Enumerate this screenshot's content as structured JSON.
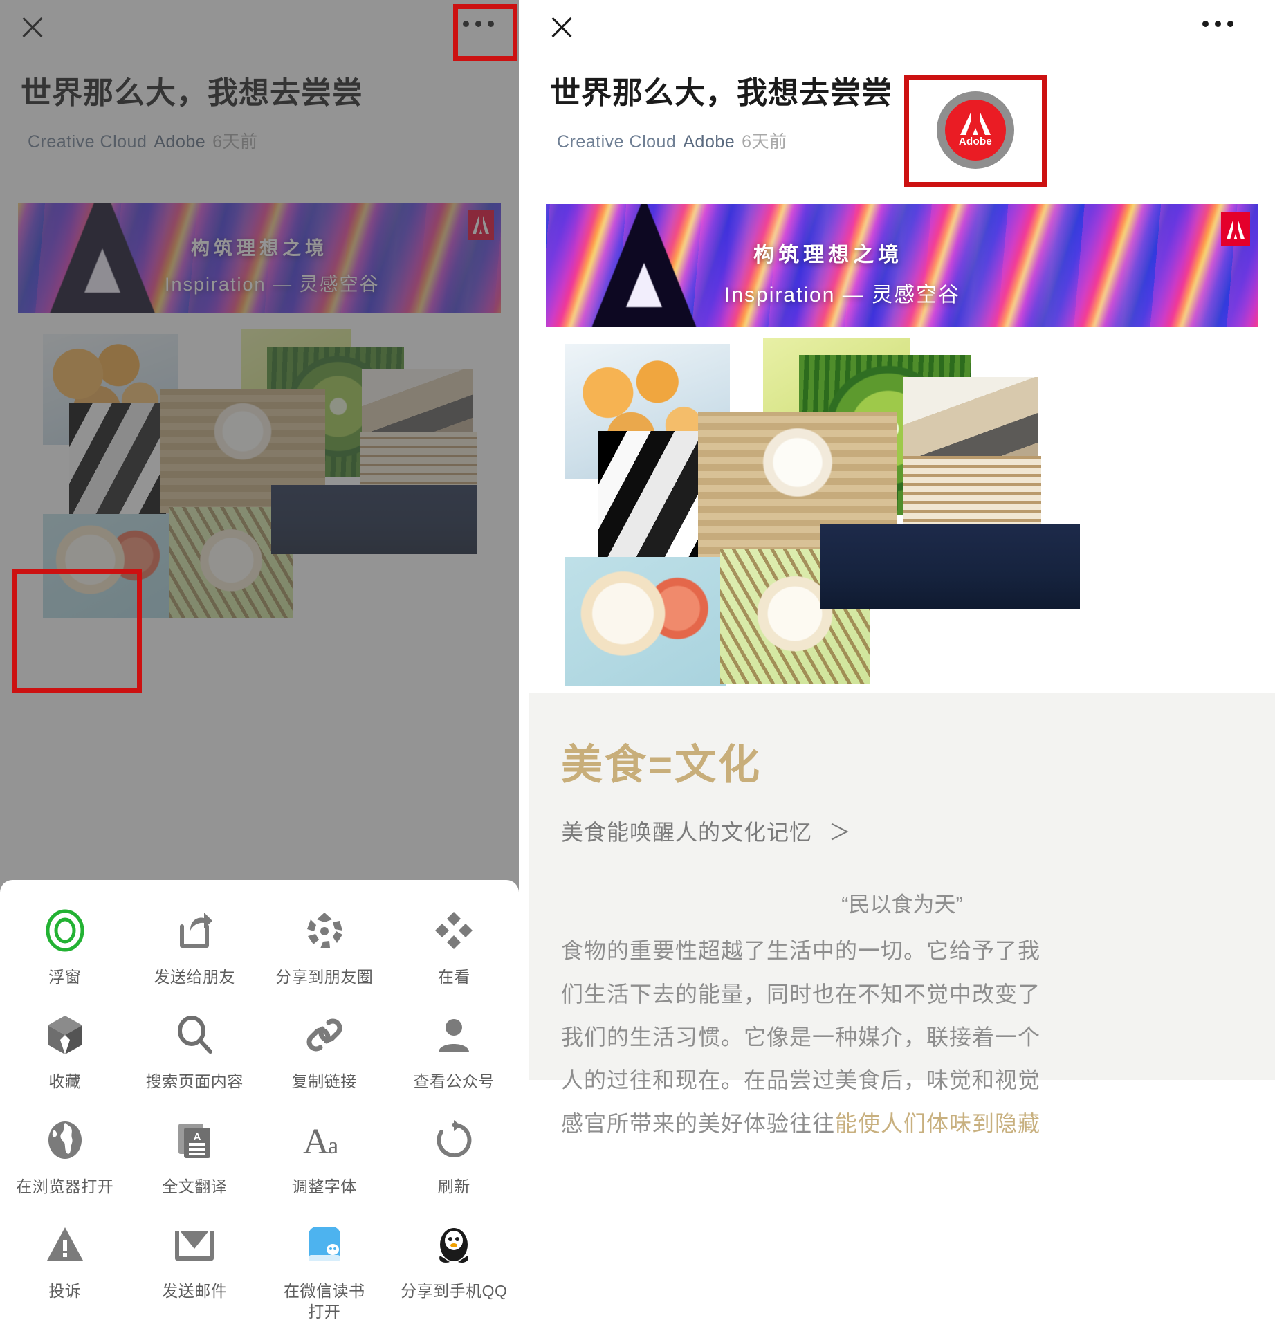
{
  "meta": {
    "app": "WeChat Official Account Article",
    "screen_description": "Two side-by-side mobile screenshots of a WeChat article; left shows the more-options action sheet, right shows the article page"
  },
  "article": {
    "title": "世界那么大，我想去尝尝",
    "account": "Creative Cloud",
    "brand": "Adobe",
    "time": "6天前",
    "close_icon": "close-icon",
    "more_icon": "more-options-icon",
    "avatar": {
      "name": "Adobe",
      "logo_word": "Adobe",
      "ring_color": "#8f8f8f",
      "badge_color": "#ea1c24"
    },
    "banner": {
      "headline": "构筑理想之境",
      "subline": "Inspiration — 灵感空谷",
      "chip_label": "Adobe",
      "chip_color": "#e4002b"
    },
    "collage_alt": "美食拼贴图：月饼、西瓜、蒸笼包子、厨师做包子、早餐盘、甜点、餐桌聚餐",
    "section_heading": "美食=文化",
    "section_sub": "美食能唤醒人的文化记忆",
    "section_sub_arrow": "＞",
    "quote": "“民以食为天”",
    "paragraph_lines": [
      "食物的重要性超越了生活中的一切。它给予了我",
      "们生活下去的能量，同时也在不知不觉中改变了",
      "我们的生活习惯。它像是一种媒介，联接着一个",
      "人的过往和现在。在品尝过美食后，味觉和视觉"
    ],
    "paragraph_last_prefix": "感官所带来的美好体验往往",
    "paragraph_last_gold": "能使人们体味到隐藏",
    "heading_color": "#c8ae7a",
    "body_color": "#8e8e8e"
  },
  "action_sheet": {
    "rows": [
      [
        {
          "label": "浮窗",
          "icon": "floating-window-icon",
          "highlighted": true,
          "color": "#2ab13f"
        },
        {
          "label": "发送给朋友",
          "icon": "share-to-friend-icon",
          "highlighted": false,
          "color": "#7b7b7b"
        },
        {
          "label": "分享到朋友圈",
          "icon": "moments-icon",
          "highlighted": false,
          "color": "#7b7b7b"
        },
        {
          "label": "在看",
          "icon": "wow-icon",
          "highlighted": false,
          "color": "#7b7b7b"
        }
      ],
      [
        {
          "label": "收藏",
          "icon": "favorite-box-icon",
          "highlighted": false,
          "color": "#7b7b7b"
        },
        {
          "label": "搜索页面内容",
          "icon": "search-icon",
          "highlighted": false,
          "color": "#7b7b7b"
        },
        {
          "label": "复制链接",
          "icon": "link-icon",
          "highlighted": false,
          "color": "#7b7b7b"
        },
        {
          "label": "查看公众号",
          "icon": "person-icon",
          "highlighted": false,
          "color": "#7b7b7b"
        }
      ],
      [
        {
          "label": "在浏览器打开",
          "icon": "globe-icon",
          "highlighted": false,
          "color": "#7b7b7b"
        },
        {
          "label": "全文翻译",
          "icon": "translate-icon",
          "highlighted": false,
          "color": "#7b7b7b"
        },
        {
          "label": "调整字体",
          "icon": "font-size-icon",
          "highlighted": false,
          "color": "#7b7b7b"
        },
        {
          "label": "刷新",
          "icon": "refresh-icon",
          "highlighted": false,
          "color": "#7b7b7b"
        }
      ],
      [
        {
          "label": "投诉",
          "icon": "warning-icon",
          "highlighted": false,
          "color": "#7b7b7b"
        },
        {
          "label": "发送邮件",
          "icon": "mail-icon",
          "highlighted": false,
          "color": "#7b7b7b"
        },
        {
          "label": "在微信读书\n打开",
          "icon": "wechat-reading-icon",
          "highlighted": false,
          "color": "#4db3ef"
        },
        {
          "label": "分享到手机QQ",
          "icon": "qq-icon",
          "highlighted": false,
          "color": "#1a1a1a"
        }
      ]
    ],
    "highlight_color": "#cc1111"
  },
  "annotations": {
    "highlight_color": "#cc1111",
    "boxes": [
      {
        "name": "left-more-button-highlight"
      },
      {
        "name": "floating-window-item-highlight"
      },
      {
        "name": "account-avatar-highlight"
      }
    ]
  }
}
